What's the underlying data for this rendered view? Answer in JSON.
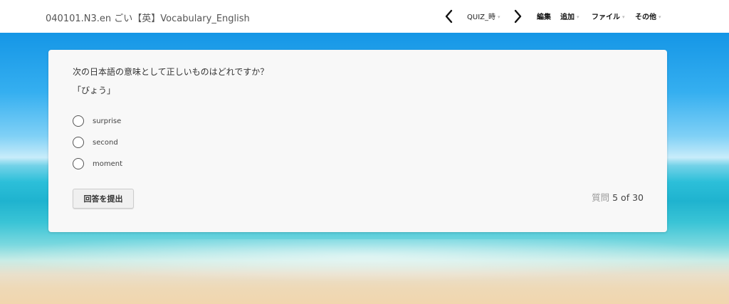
{
  "header": {
    "title": "040101.N3.en ごい【英】Vocabulary_English",
    "prev_icon": "chevron-left-icon",
    "next_icon": "chevron-right-icon",
    "quiz_name": "QUIZ_時",
    "menu": {
      "edit": "編集",
      "add": "追加",
      "file": "ファイル",
      "other": "その他"
    }
  },
  "question": {
    "prompt": "次の日本語の意味として正しいものはどれですか？",
    "term": "「びょう」",
    "options": [
      {
        "label": "surprise"
      },
      {
        "label": "second"
      },
      {
        "label": "moment"
      }
    ],
    "submit_label": "回答を提出"
  },
  "progress": {
    "prefix": "質問",
    "current": "5",
    "of": "of",
    "total": "30"
  },
  "colors": {
    "header_bg": "#ffffff",
    "card_bg": "#f8f8f8",
    "sky": "#1596e6",
    "sea": "#2cbfd9",
    "sand": "#f1d6ae"
  }
}
